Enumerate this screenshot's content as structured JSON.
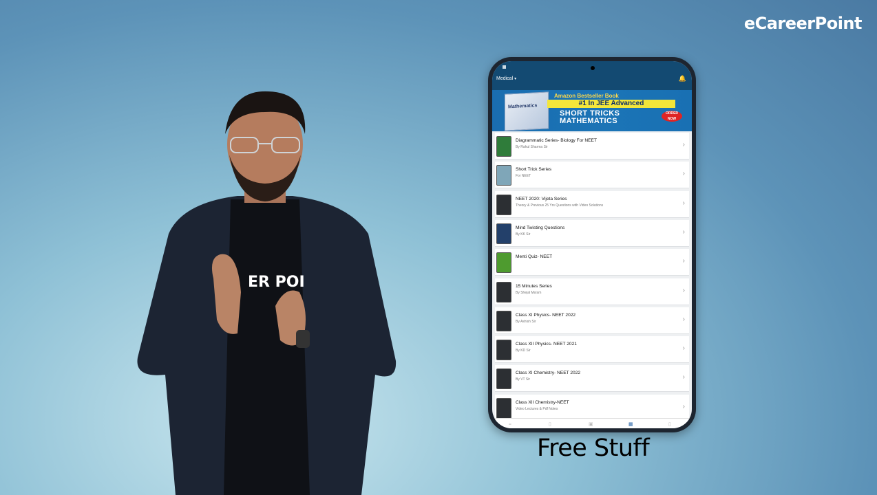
{
  "brand": "eCareerPoint",
  "caption": "Free Stuff",
  "app": {
    "stream": "Medical",
    "banner": {
      "line1": "Amazon Bestseller Book",
      "line2": "#1 In JEE Advanced",
      "line3": "SHORT TRICKS",
      "line4": "MATHEMATICS",
      "order": "ORDER NOW",
      "book_title": "Mathematics"
    },
    "items": [
      {
        "title": "Diagrammatic Series- Biology For NEET",
        "sub": "By Rahul Sharma Sir",
        "thumb": "green"
      },
      {
        "title": "Short Trick Series",
        "sub": "For NEET",
        "thumb": "teal"
      },
      {
        "title": "NEET 2020: Vijeta Series",
        "sub": "Theory & Previous 25 Yrs Questions with Video Solutions",
        "thumb": "dark"
      },
      {
        "title": "Mind Twisting Questions",
        "sub": "By KK Sir",
        "thumb": "navy"
      },
      {
        "title": "Menti Quiz- NEET",
        "sub": "",
        "thumb": "lime"
      },
      {
        "title": "15 Minutes Series",
        "sub": "By Shejal Ma'am",
        "thumb": "dark"
      },
      {
        "title": "Class XI Physics- NEET 2022",
        "sub": "By Ashish Sir",
        "thumb": "dark"
      },
      {
        "title": "Class XII Physics- NEET 2021",
        "sub": "By KD Sir",
        "thumb": "dark"
      },
      {
        "title": "Class XI Chemistry- NEET 2022",
        "sub": "By VT Sir",
        "thumb": "dark"
      },
      {
        "title": "Class XII Chemistry-NEET",
        "sub": "Video Lectures & Pdf Notes",
        "thumb": "dark"
      }
    ]
  },
  "shirt_text": "ER POI"
}
